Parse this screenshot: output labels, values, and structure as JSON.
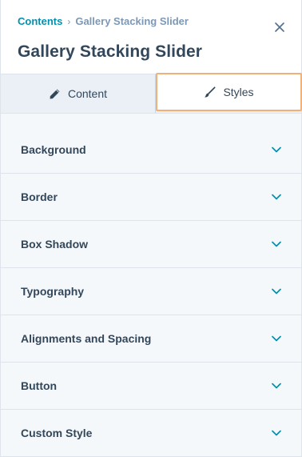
{
  "breadcrumb": {
    "parent": "Contents",
    "separator": "›",
    "current": "Gallery Stacking Slider"
  },
  "header": {
    "title": "Gallery Stacking Slider"
  },
  "tabs": [
    {
      "label": "Content",
      "icon": "pencil-icon",
      "active": false
    },
    {
      "label": "Styles",
      "icon": "brush-icon",
      "active": true
    }
  ],
  "sections": [
    {
      "label": "Background"
    },
    {
      "label": "Border"
    },
    {
      "label": "Box Shadow"
    },
    {
      "label": "Typography"
    },
    {
      "label": "Alignments and Spacing"
    },
    {
      "label": "Button"
    },
    {
      "label": "Custom Style"
    }
  ],
  "colors": {
    "accent": "#0091ae",
    "text": "#33475b",
    "muted": "#7c98b6",
    "focus_outline": "#f0b27a",
    "tab_bar": "#eaf0f6",
    "section_bg": "#f5f8fa"
  }
}
